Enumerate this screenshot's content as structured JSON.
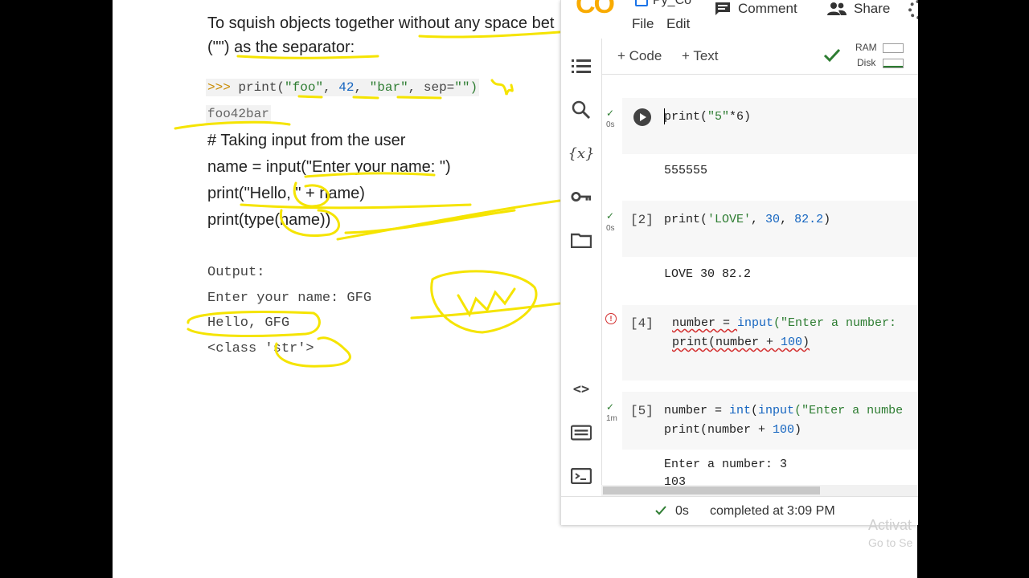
{
  "document": {
    "para_line1": "To squish objects together without any space bet",
    "para_line2": "(\"\") as the separator:",
    "example_prompt": ">>>",
    "example_print": "print(",
    "example_foo": "\"foo\"",
    "example_sep1": ", ",
    "example_42": "42",
    "example_sep2": ", ",
    "example_bar": "\"bar\"",
    "example_sep3": ", sep=",
    "example_empty": "\"\")",
    "example_output": "foo42bar",
    "code_line1": "# Taking input from the user",
    "code_line2": "name = input(\"Enter your name: \")",
    "code_line3": "print(\"Hello, \" + name)",
    "code_line4": "print(type(name))",
    "out_label": "Output:",
    "out_line1": "Enter your name: GFG",
    "out_line2": "Hello, GFG",
    "out_line3": "<class 'str'>"
  },
  "colab": {
    "logo": "CO",
    "notebook_title": "Py_Co",
    "menu_file": "File",
    "menu_edit": "Edit",
    "comment_label": "Comment",
    "share_label": "Share",
    "add_code": "+ Code",
    "add_text": "+ Text",
    "ram_label": "RAM",
    "disk_label": "Disk",
    "cells": [
      {
        "exec": "",
        "time": "0s",
        "code_a": "print(",
        "code_b": "\"5\"",
        "code_c": "*6)",
        "output": "555555"
      },
      {
        "exec": "[2]",
        "time": "0s",
        "code_a": "print(",
        "code_b": "'LOVE'",
        "code_c": ", ",
        "code_d": "30",
        "code_e": ", ",
        "code_f": "82.2",
        "code_g": ")",
        "output": "LOVE 30 82.2"
      },
      {
        "exec": "[4]",
        "time": "",
        "line1_a": "number = ",
        "line1_b": "input",
        "line1_c": "(\"Enter a number:",
        "line2_a": "print(number + ",
        "line2_b": "100",
        "line2_c": ")"
      },
      {
        "exec": "[5]",
        "time": "1m",
        "line1_a": "number = ",
        "line1_b": "int",
        "line1_c": "(",
        "line1_d": "input",
        "line1_e": "(\"Enter a numbe",
        "line2_a": "print(number + ",
        "line2_b": "100",
        "line2_c": ")",
        "output1": "Enter a number: 3",
        "output2": "103"
      }
    ],
    "status_time": "0s",
    "status_text": "completed at 3:09 PM"
  },
  "watermark": {
    "line1": "Activat",
    "line2": "Go to Se"
  },
  "colors": {
    "highlighter": "#f5e400",
    "string": "#2e7d32",
    "number": "#1565c0",
    "check": "#2e7d32",
    "error": "#d32f2f"
  }
}
